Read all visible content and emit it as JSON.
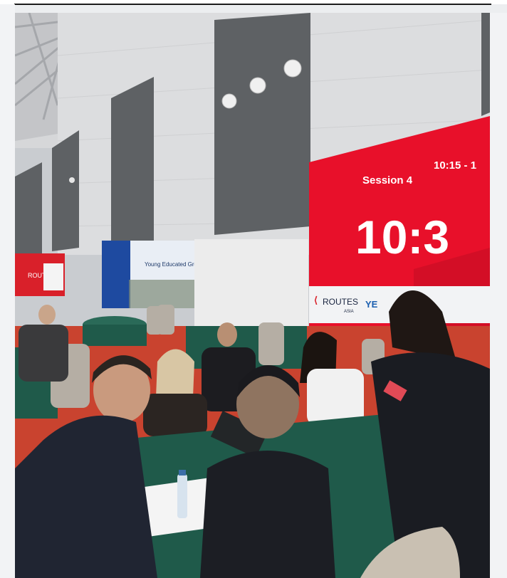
{
  "photo": {
    "screen": {
      "session_label": "Session 4",
      "session_time": "10:15 - 1",
      "clock": "10:3",
      "sponsor_logo_text": "ROUTES",
      "sponsor_logo_sub": "ASIA",
      "partner_logo_text": "YE"
    },
    "banner": {
      "tagline": "Young Educated Growing."
    },
    "left_booth": {
      "logo_text": "ROUTES"
    },
    "colors": {
      "screen_red": "#e8102a",
      "tablecloth": "#1f5a4a",
      "floor": "#c9432f",
      "wall": "#d9dadb",
      "panel": "#5d6063"
    }
  }
}
